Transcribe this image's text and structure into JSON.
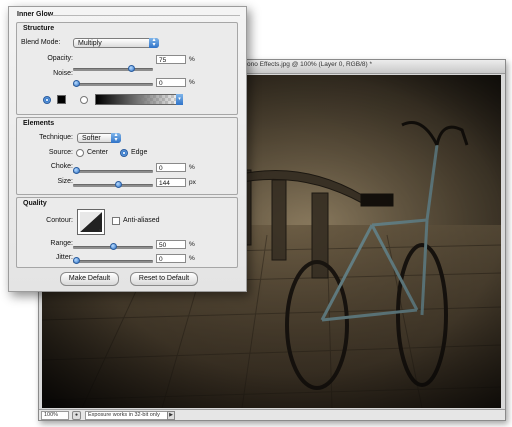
{
  "document": {
    "title": "ono Effects.jpg @ 100% (Layer 0, RGB/8) *",
    "status_zoom": "100%",
    "status_message": "Exposure works in 32-bit only"
  },
  "dialog": {
    "title": "Inner Glow",
    "structure": {
      "title": "Structure",
      "blend_mode_label": "Blend Mode:",
      "blend_mode_value": "Multiply",
      "opacity_label": "Opacity:",
      "opacity_value": "75",
      "opacity_unit": "%",
      "opacity_level": 0.75,
      "noise_label": "Noise:",
      "noise_value": "0",
      "noise_unit": "%",
      "noise_level": 0,
      "color_mode": "solid",
      "color_swatch": "#000000"
    },
    "elements": {
      "title": "Elements",
      "technique_label": "Technique:",
      "technique_value": "Softer",
      "source_label": "Source:",
      "source_center_label": "Center",
      "source_edge_label": "Edge",
      "source_selected": "Edge",
      "choke_label": "Choke:",
      "choke_value": "0",
      "choke_unit": "%",
      "choke_level": 0,
      "size_label": "Size:",
      "size_value": "144",
      "size_unit": "px",
      "size_level": 0.58
    },
    "quality": {
      "title": "Quality",
      "contour_label": "Contour:",
      "anti_aliased_label": "Anti-aliased",
      "anti_aliased_checked": false,
      "range_label": "Range:",
      "range_value": "50",
      "range_unit": "%",
      "range_level": 0.5,
      "jitter_label": "Jitter:",
      "jitter_value": "0",
      "jitter_unit": "%",
      "jitter_level": 0
    },
    "buttons": {
      "make_default": "Make Default",
      "reset_to_default": "Reset to Default"
    }
  },
  "colors": {
    "accent": "#2f73c8",
    "dialog_bg": "#ebebeb"
  }
}
